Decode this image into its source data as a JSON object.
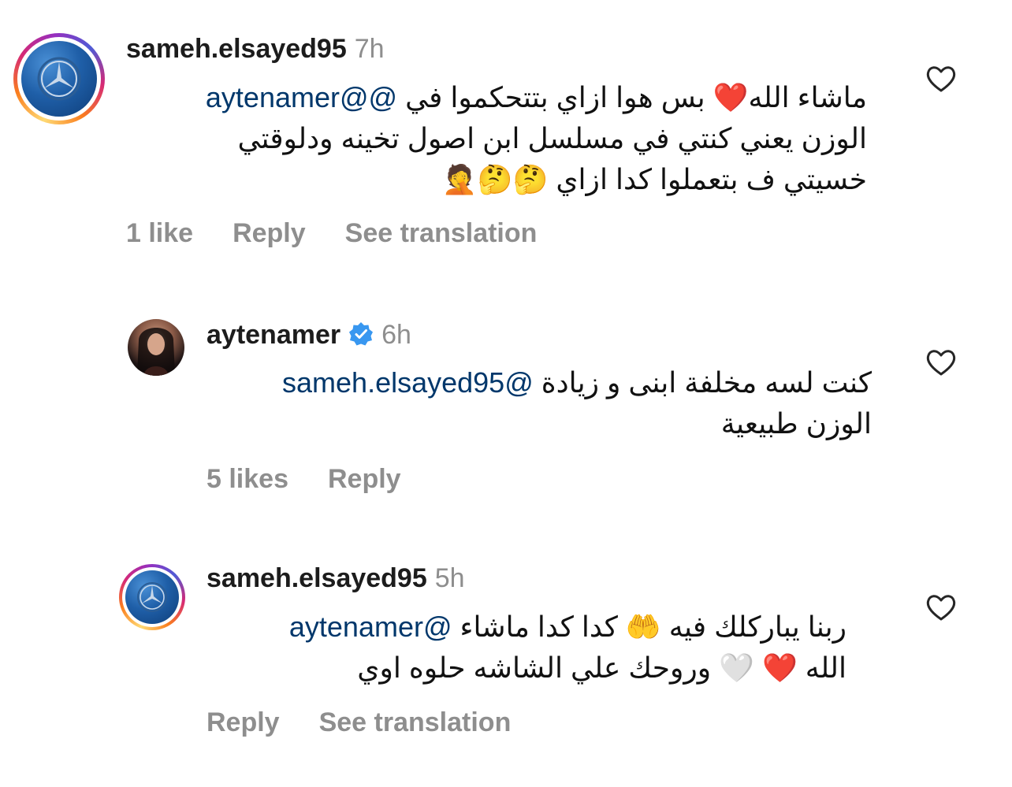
{
  "comments": [
    {
      "username": "sameh.elsayed95",
      "time": "7h",
      "verified": false,
      "avatar_icon": "mercedes-logo-icon",
      "line1_text": "ماشاء الله❤️ بس هوا ازاي بتتحكموا في ",
      "line1_mention": "@@aytenamer",
      "line2_text": "الوزن يعني كنتي في مسلسل ابن اصول تخينه ودلوقتي",
      "line3_text": "خسيتي ف بتعملوا كدا ازاي 🤔🤔🤦",
      "likes": "1 like",
      "reply": "Reply",
      "see_translation": "See translation"
    },
    {
      "username": "aytenamer",
      "time": "6h",
      "verified": true,
      "avatar_icon": "profile-photo-icon",
      "line1_text": "كنت لسه مخلفة ابنى و زيادة ",
      "line1_mention": "@sameh.elsayed95",
      "line2_text": "الوزن طبيعية",
      "likes": "5 likes",
      "reply": "Reply"
    },
    {
      "username": "sameh.elsayed95",
      "time": "5h",
      "verified": false,
      "avatar_icon": "mercedes-logo-icon",
      "line1_text": "ربنا يباركلك فيه 🤲 كدا كدا ماشاء ",
      "line1_mention": "@aytenamer",
      "line2_text": "الله ❤️ 🤍 وروحك علي الشاشه حلوه اوي",
      "reply": "Reply",
      "see_translation": "See translation"
    }
  ],
  "colors": {
    "username": "#1c1c1c",
    "muted": "#8e8e8e",
    "mention": "#00376b",
    "verified_badge": "#3897f0"
  }
}
